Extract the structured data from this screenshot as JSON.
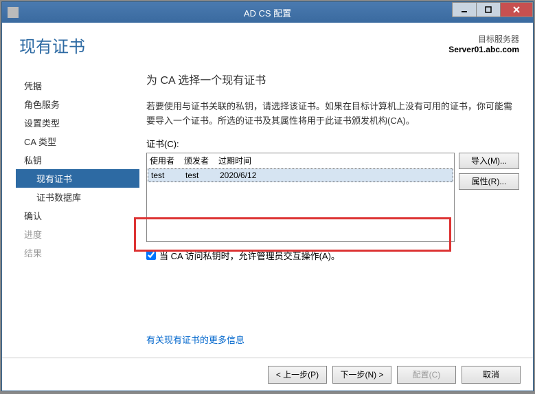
{
  "titlebar": {
    "title": "AD CS 配置"
  },
  "header": {
    "page_title": "现有证书",
    "target_label": "目标服务器",
    "target_server": "Server01.abc.com"
  },
  "sidebar": {
    "items": [
      {
        "label": "凭据"
      },
      {
        "label": "角色服务"
      },
      {
        "label": "设置类型"
      },
      {
        "label": "CA 类型"
      },
      {
        "label": "私钥"
      },
      {
        "label": "现有证书"
      },
      {
        "label": "证书数据库"
      },
      {
        "label": "确认"
      },
      {
        "label": "进度"
      },
      {
        "label": "结果"
      }
    ]
  },
  "main": {
    "title": "为 CA 选择一个现有证书",
    "desc": "若要使用与证书关联的私钥，请选择该证书。如果在目标计算机上没有可用的证书，你可能需要导入一个证书。所选的证书及其属性将用于此证书颁发机构(CA)。",
    "cert_label": "证书(C):",
    "columns": {
      "user": "使用者",
      "issuer": "颁发者",
      "expiry": "过期时间"
    },
    "rows": [
      {
        "user": "test",
        "issuer": "test",
        "expiry": "2020/6/12"
      }
    ],
    "import_btn": "导入(M)...",
    "props_btn": "属性(R)...",
    "checkbox_label": "当 CA 访问私钥时，允许管理员交互操作(A)。",
    "link_more": "有关现有证书的更多信息"
  },
  "footer": {
    "prev": "< 上一步(P)",
    "next": "下一步(N) >",
    "config": "配置(C)",
    "cancel": "取消"
  }
}
